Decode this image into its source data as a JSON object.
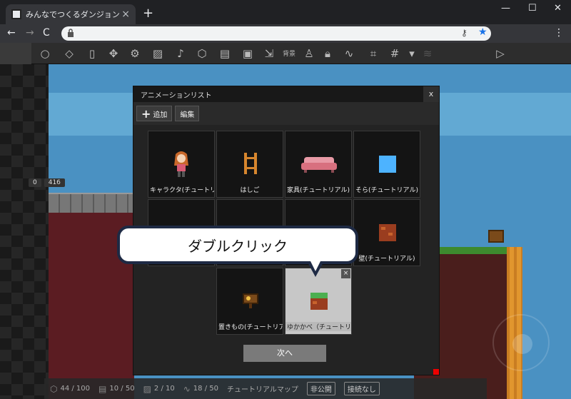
{
  "browser": {
    "tab_title": "みんなでつくるダンジョン",
    "new_tab": "+",
    "tab_close": "×",
    "window_controls": [
      "—",
      "☐",
      "✕"
    ],
    "nav": [
      "←",
      "→",
      "C"
    ]
  },
  "app_toolbar": {
    "background_label": "背景"
  },
  "game": {
    "counters": [
      "0",
      "416"
    ]
  },
  "dialog": {
    "title": "アニメーションリスト",
    "close": "x",
    "add_label": "追加",
    "edit_label": "編集",
    "items": [
      "キャラクタ(チュートリアル)",
      "はしご",
      "家具(チュートリアル)",
      "そら(チュートリアル)",
      "",
      "",
      "",
      "壁(チュートリアル)",
      "置きもの(チュートリアル)",
      "ゆかかべ（チュートリアル）"
    ],
    "next_label": "次へ"
  },
  "callout": {
    "text": "ダブルクリック"
  },
  "statusbar": {
    "counts": [
      "44 / 100",
      "10 / 50",
      "2 / 10",
      "18 / 50"
    ],
    "map_name": "チュートリアルマップ",
    "private": "非公開",
    "connection": "接続なし"
  },
  "colors": {
    "accent_blue": "#1a73e8",
    "sky": "#4a91c2",
    "callout_border": "#1e2a44"
  }
}
